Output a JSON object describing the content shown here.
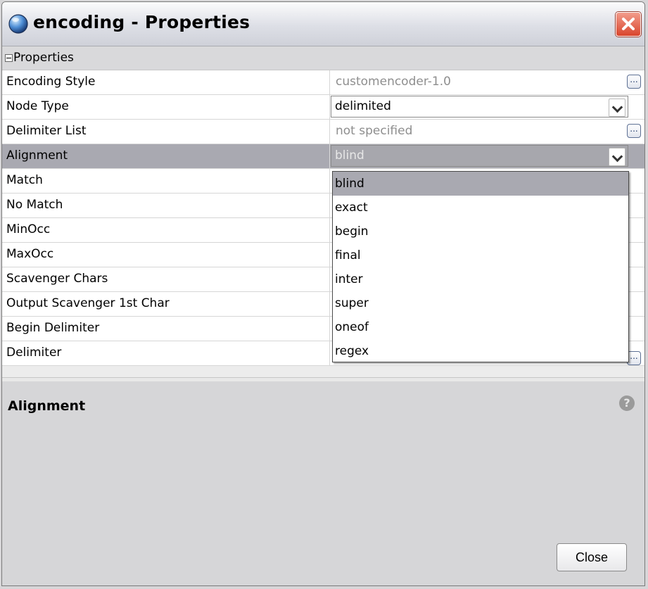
{
  "window": {
    "title": "encoding - Properties",
    "icons": {
      "app": "sphere-icon",
      "close": "close-icon"
    }
  },
  "section": {
    "label": "Properties",
    "icon": "collapse-minus-icon"
  },
  "properties": [
    {
      "name": "Encoding Style",
      "value": "customencoder-1.0",
      "editor": "ellipsis"
    },
    {
      "name": "Node Type",
      "value": "delimited",
      "editor": "dropdown"
    },
    {
      "name": "Delimiter List",
      "value": "not specified",
      "editor": "ellipsis"
    },
    {
      "name": "Alignment",
      "value": "blind",
      "editor": "dropdown",
      "selected": true
    },
    {
      "name": "Match",
      "value": ""
    },
    {
      "name": "No Match",
      "value": ""
    },
    {
      "name": "MinOcc",
      "value": ""
    },
    {
      "name": "MaxOcc",
      "value": ""
    },
    {
      "name": "Scavenger Chars",
      "value": ""
    },
    {
      "name": "Output Scavenger 1st Char",
      "value": ""
    },
    {
      "name": "Begin Delimiter",
      "value": ""
    },
    {
      "name": "Delimiter",
      "value": ""
    }
  ],
  "editors": {
    "ellipsis_label": "..."
  },
  "dropdown": {
    "options": [
      "blind",
      "exact",
      "begin",
      "final",
      "inter",
      "super",
      "oneof",
      "regex"
    ],
    "highlighted": "blind"
  },
  "description": {
    "title": "Alignment",
    "help_icon": "help-icon",
    "help_glyph": "?"
  },
  "footer": {
    "close_label": "Close"
  },
  "colors": {
    "selected_row": "#a9a9b1",
    "close_red": "#d9452d"
  }
}
